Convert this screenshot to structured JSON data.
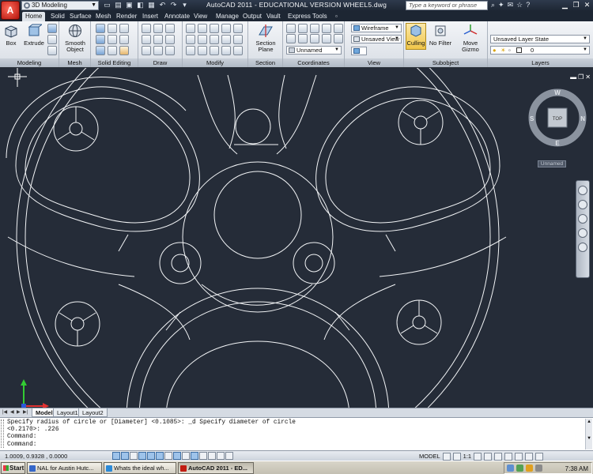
{
  "titlebar": {
    "workspace": "3D Modeling",
    "title": "AutoCAD 2011 - EDUCATIONAL VERSION    WHEEL5.dwg",
    "search_placeholder": "Type a keyword or phrase",
    "app_logo": "A"
  },
  "ribbon_tabs": [
    "Home",
    "Solid",
    "Surface",
    "Mesh",
    "Render",
    "Insert",
    "Annotate",
    "View",
    "Manage",
    "Output",
    "Vault",
    "Express Tools"
  ],
  "ribbon": {
    "box_label": "Box",
    "extrude_label": "Extrude",
    "smooth_object_label": "Smooth Object",
    "section_plane_label": "Section Plane",
    "culling_label": "Culling",
    "no_filter_label": "No Filter",
    "move_gizmo_label": "Move Gizmo",
    "visual_style": "Wireframe",
    "view_name": "Unsaved View",
    "coord_name": "Unnamed",
    "layer_state": "Unsaved Layer State",
    "layer_current": "0",
    "panels": {
      "modeling": "Modeling",
      "mesh": "Mesh",
      "solid_editing": "Solid Editing",
      "draw": "Draw",
      "modify": "Modify",
      "section": "Section",
      "coordinates": "Coordinates",
      "view": "View",
      "subobject": "Subobject",
      "layers": "Layers"
    }
  },
  "viewport": {
    "viewcube_face": "TOP",
    "compass": {
      "n": "N",
      "s": "S",
      "e": "E",
      "w": "W"
    },
    "ucs_name_button": "Unnamed",
    "ucs_x": "X",
    "ucs_y": "Y"
  },
  "layout_tabs": [
    "Model",
    "Layout1",
    "Layout2"
  ],
  "command_line": [
    "Specify radius of circle or [Diameter] <0.1085>: _d Specify diameter of circle",
    "<0.2170>: .226",
    "Command:",
    "Command:"
  ],
  "statusbar": {
    "coords": "1.0009, 0.9328 , 0.0000",
    "model_label": "MODEL",
    "scale": "1:1"
  },
  "taskbar": {
    "start": "Start",
    "tasks": [
      "NAL for Austin Hutc...",
      "Whats the ideal wh...",
      "AutoCAD 2011 - ED..."
    ],
    "clock": "7:38 AM"
  },
  "colors": {
    "canvas_bg": "#252c38",
    "geometry": "#f2f4f6",
    "title_bg": "#1d2633",
    "ribbon_bg": "#e3e7ec"
  }
}
